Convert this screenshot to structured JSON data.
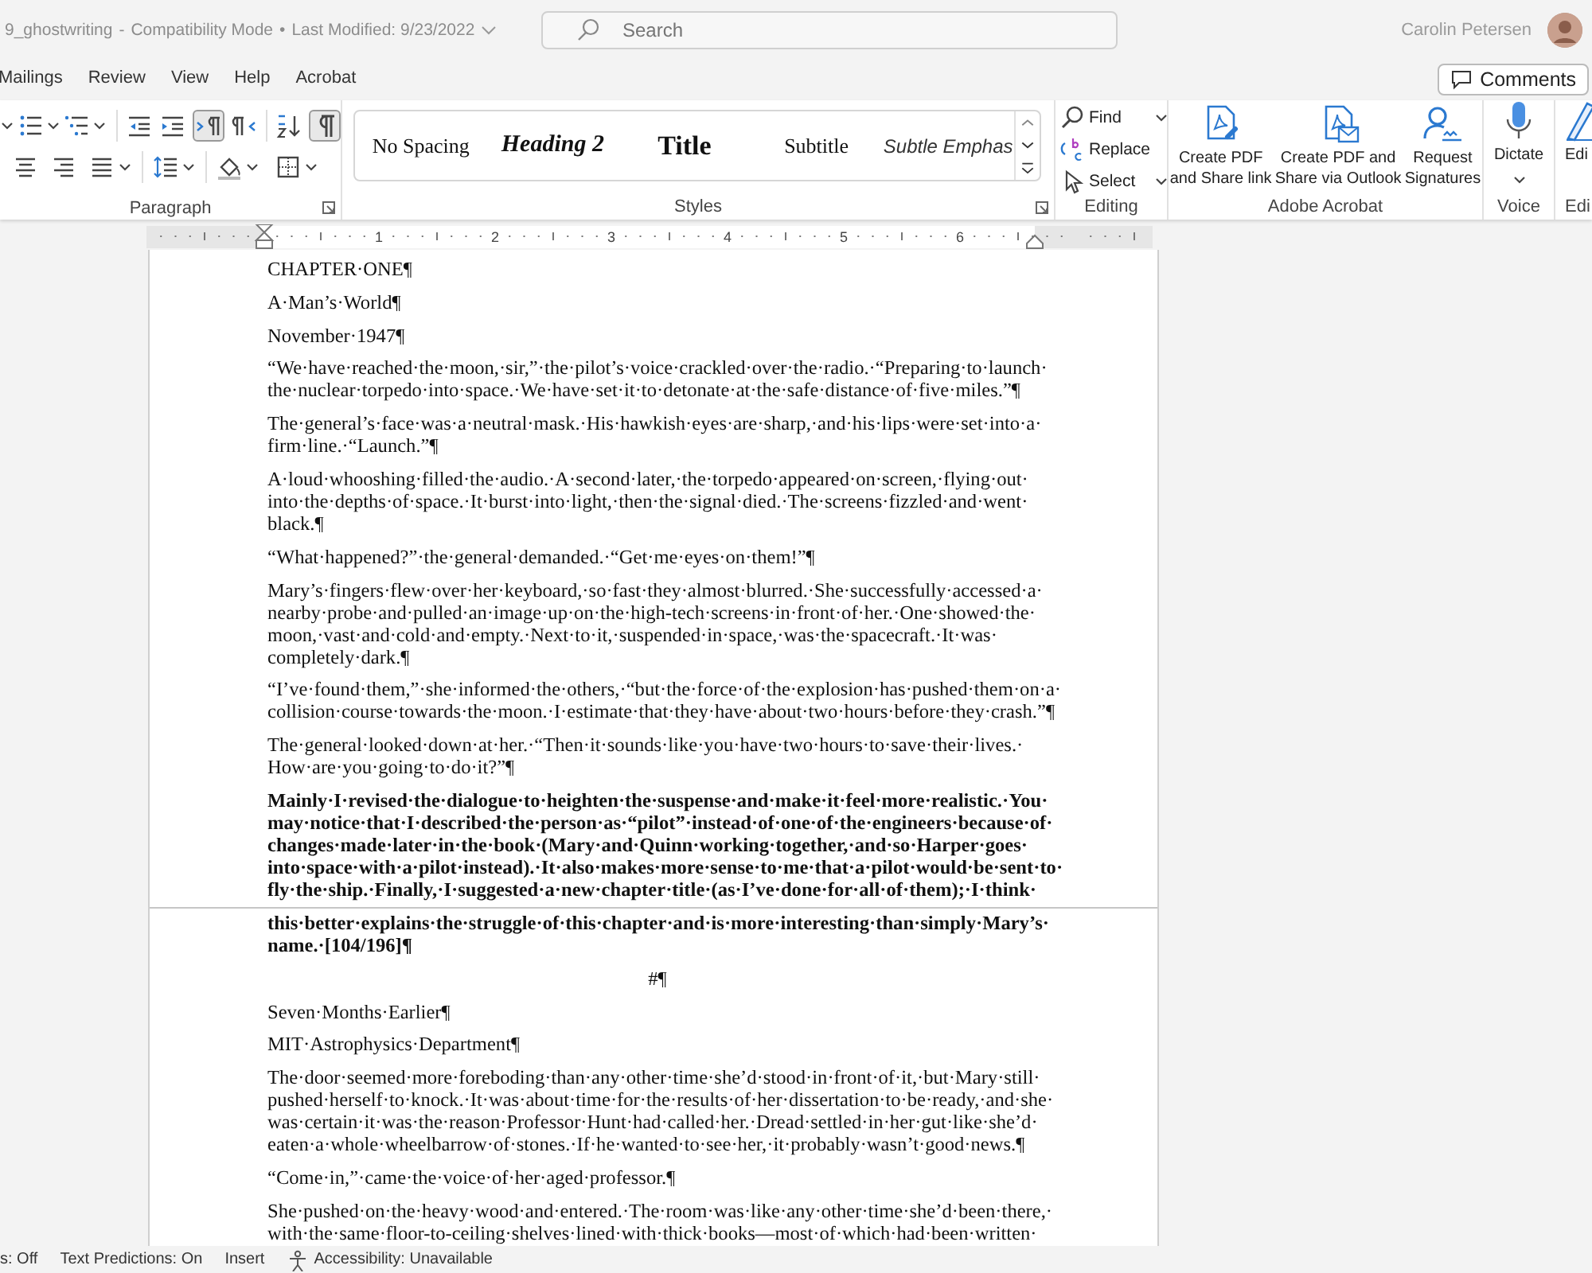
{
  "title_bar": {
    "document_title": "9_ghostwriting",
    "separator": "-",
    "mode": "Compatibility Mode",
    "dot": "•",
    "last_modified": "Last Modified: 9/23/2022",
    "search": {
      "placeholder": "Search"
    },
    "user_name": "Carolin Petersen"
  },
  "ribbon_tabs": [
    {
      "label": "Mailings",
      "selected": false
    },
    {
      "label": "Review",
      "selected": false
    },
    {
      "label": "View",
      "selected": false
    },
    {
      "label": "Help",
      "selected": false
    },
    {
      "label": "Acrobat",
      "selected": false
    }
  ],
  "comments_button": "Comments",
  "ribbon": {
    "paragraph": {
      "label": "Paragraph",
      "left_to_right_on": true,
      "show_marks_on": true
    },
    "styles": {
      "label": "Styles",
      "items": [
        {
          "label": "No Spacing",
          "kind": "plain"
        },
        {
          "label": "Heading 2",
          "kind": "heading"
        },
        {
          "label": "Title",
          "kind": "title"
        },
        {
          "label": "Subtitle",
          "kind": "subtitle"
        },
        {
          "label": "Subtle Emphas",
          "kind": "emphasis"
        }
      ]
    },
    "editing": {
      "label": "Editing",
      "items": [
        {
          "label": "Find",
          "dropdown": true
        },
        {
          "label": "Replace",
          "dropdown": false
        },
        {
          "label": "Select",
          "dropdown": true
        }
      ]
    },
    "acrobat": {
      "label": "Adobe Acrobat",
      "items": [
        {
          "lines": [
            "Create PDF",
            "and Share link"
          ]
        },
        {
          "lines": [
            "Create PDF and",
            "Share via Outlook"
          ]
        },
        {
          "lines": [
            "Request",
            "Signatures"
          ]
        }
      ]
    },
    "voice": {
      "label": "Voice",
      "button": "Dictate"
    },
    "cut_group": {
      "label": "Edi",
      "button": "Edi"
    }
  },
  "ruler": {
    "numbers": [
      "1",
      "2",
      "3",
      "4",
      "5",
      "6"
    ]
  },
  "pages": [
    {
      "paragraphs": [
        {
          "bold": false,
          "centered": false,
          "lines": [
            "CHAPTER·ONE¶"
          ]
        },
        {
          "bold": false,
          "centered": false,
          "lines": [
            "A·Man’s·World¶"
          ]
        },
        {
          "bold": false,
          "centered": false,
          "lines": [
            "November·1947¶"
          ]
        },
        {
          "bold": false,
          "centered": false,
          "lines": [
            "“We·have·reached·the·moon,·sir,”·the·pilot’s·voice·crackled·over·the·radio.·“Preparing·to·launch·",
            "the·nuclear·torpedo·into·space.·We·have·set·it·to·detonate·at·the·safe·distance·of·five·miles.”¶"
          ]
        },
        {
          "bold": false,
          "centered": false,
          "lines": [
            "The·general’s·face·was·a·neutral·mask.·His·hawkish·eyes·are·sharp,·and·his·lips·were·set·into·a·",
            "firm·line.·“Launch.”¶"
          ]
        },
        {
          "bold": false,
          "centered": false,
          "lines": [
            "A·loud·whooshing·filled·the·audio.·A·second·later,·the·torpedo·appeared·on·screen,·flying·out·",
            "into·the·depths·of·space.·It·burst·into·light,·then·the·signal·died.·The·screens·fizzled·and·went·",
            "black.¶"
          ]
        },
        {
          "bold": false,
          "centered": false,
          "lines": [
            "“What·happened?”·the·general·demanded.·“Get·me·eyes·on·them!”¶"
          ]
        },
        {
          "bold": false,
          "centered": false,
          "lines": [
            "Mary’s·fingers·flew·over·her·keyboard,·so·fast·they·almost·blurred.·She·successfully·accessed·a·",
            "nearby·probe·and·pulled·an·image·up·on·the·high-tech·screens·in·front·of·her.·One·showed·the·",
            "moon,·vast·and·cold·and·empty.·Next·to·it,·suspended·in·space,·was·the·spacecraft.·It·was·",
            "completely·dark.¶"
          ]
        },
        {
          "bold": false,
          "centered": false,
          "lines": [
            "“I’ve·found·them,”·she·informed·the·others,·“but·the·force·of·the·explosion·has·pushed·them·on·a·",
            "collision·course·towards·the·moon.·I·estimate·that·they·have·about·two·hours·before·they·crash.”¶"
          ]
        },
        {
          "bold": false,
          "centered": false,
          "lines": [
            "The·general·looked·down·at·her.·“Then·it·sounds·like·you·have·two·hours·to·save·their·lives.·",
            "How·are·you·going·to·do·it?”¶"
          ]
        },
        {
          "bold": true,
          "centered": false,
          "lines": [
            "Mainly·I·revised·the·dialogue·to·heighten·the·suspense·and·make·it·feel·more·realistic.·You·",
            "may·notice·that·I·described·the·person·as·“pilot”·instead·of·one·of·the·engineers·because·of·",
            "changes·made·later·in·the·book·(Mary·and·Quinn·working·together,·and·so·Harper·goes·",
            "into·space·with·a·pilot·instead).·It·also·makes·more·sense·to·me·that·a·pilot·would·be·sent·to·",
            "fly·the·ship.·Finally,·I·suggested·a·new·chapter·title·(as·I’ve·done·for·all·of·them);·I·think·"
          ]
        }
      ]
    },
    {
      "paragraphs": [
        {
          "bold": true,
          "centered": false,
          "lines": [
            "this·better·explains·the·struggle·of·this·chapter·and·is·more·interesting·than·simply·Mary’s·",
            "name.·[104/196]¶"
          ]
        },
        {
          "bold": false,
          "centered": true,
          "lines": [
            "#¶"
          ]
        },
        {
          "bold": false,
          "centered": false,
          "lines": [
            "Seven·Months·Earlier¶"
          ]
        },
        {
          "bold": false,
          "centered": false,
          "lines": [
            "MIT·Astrophysics·Department¶"
          ]
        },
        {
          "bold": false,
          "centered": false,
          "lines": [
            "The·door·seemed·more·foreboding·than·any·other·time·she’d·stood·in·front·of·it,·but·Mary·still·",
            "pushed·herself·to·knock.·It·was·about·time·for·the·results·of·her·dissertation·to·be·ready,·and·she·",
            "was·certain·it·was·the·reason·Professor·Hunt·had·called·her.·Dread·settled·in·her·gut·like·she’d·",
            "eaten·a·whole·wheelbarrow·of·stones.·If·he·wanted·to·see·her,·it·probably·wasn’t·good·news.¶"
          ]
        },
        {
          "bold": false,
          "centered": false,
          "lines": [
            "“Come·in,”·came·the·voice·of·her·aged·professor.¶"
          ]
        },
        {
          "bold": false,
          "centered": false,
          "lines": [
            "She·pushed·on·the·heavy·wood·and·entered.·The·room·was·like·any·other·time·she’d·been·there,·",
            "with·the·same·floor-to-ceiling·shelves·lined·with·thick·books—most·of·which·had·been·written·"
          ]
        }
      ]
    }
  ],
  "status_bar": [
    {
      "text": "s: Off",
      "icon": false
    },
    {
      "text": "Text Predictions: On",
      "icon": false
    },
    {
      "text": "Insert",
      "icon": false
    },
    {
      "text": "Accessibility: Unavailable",
      "icon": true
    }
  ]
}
